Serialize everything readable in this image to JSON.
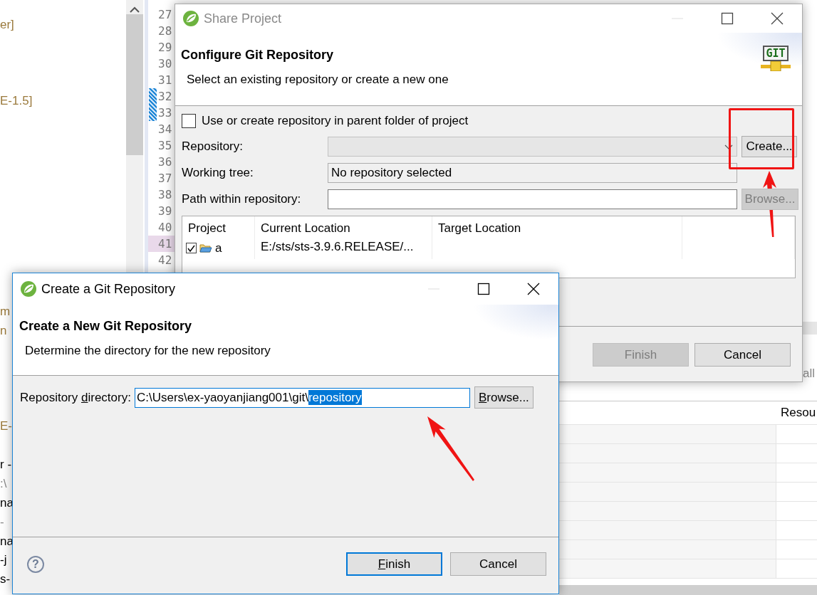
{
  "ide": {
    "explorer_rows": [
      {
        "kind": "decoration",
        "text": "er]"
      },
      {
        "kind": "blank"
      },
      {
        "kind": "blank"
      },
      {
        "kind": "blank"
      },
      {
        "kind": "decoration",
        "text": "E-1.5]"
      },
      {
        "kind": "blank"
      },
      {
        "kind": "blank"
      },
      {
        "kind": "blank"
      },
      {
        "kind": "blank"
      },
      {
        "kind": "blank"
      },
      {
        "kind": "blank"
      },
      {
        "kind": "blank"
      },
      {
        "kind": "blank"
      },
      {
        "kind": "blank"
      },
      {
        "kind": "blank"
      },
      {
        "kind": "decoration",
        "text": "m"
      },
      {
        "kind": "decoration",
        "text": "n"
      },
      {
        "kind": "blank"
      },
      {
        "kind": "blank"
      },
      {
        "kind": "blank"
      },
      {
        "kind": "blank"
      },
      {
        "kind": "decoration",
        "text": "E-"
      },
      {
        "kind": "blank"
      },
      {
        "kind": "label",
        "text": "r -"
      },
      {
        "kind": "path",
        "text": ":\\"
      },
      {
        "kind": "label",
        "text": "na"
      },
      {
        "kind": "path",
        "text": "-"
      },
      {
        "kind": "label",
        "text": "na"
      },
      {
        "kind": "label",
        "text": "-j"
      },
      {
        "kind": "label",
        "text": "s-"
      }
    ],
    "editor_lines": [
      {
        "number": "27",
        "kind": "plain"
      },
      {
        "number": "28",
        "kind": "plain"
      },
      {
        "number": "29",
        "kind": "plain"
      },
      {
        "number": "30",
        "kind": "plain"
      },
      {
        "number": "31",
        "kind": "plain"
      },
      {
        "number": "32",
        "kind": "marked"
      },
      {
        "number": "33",
        "kind": "marked"
      },
      {
        "number": "34",
        "kind": "plain"
      },
      {
        "number": "35",
        "kind": "plain"
      },
      {
        "number": "36",
        "kind": "plain"
      },
      {
        "number": "37",
        "kind": "plain"
      },
      {
        "number": "38",
        "kind": "plain"
      },
      {
        "number": "39",
        "kind": "plain"
      },
      {
        "number": "40",
        "kind": "plain"
      },
      {
        "number": "41",
        "kind": "highlighted"
      },
      {
        "number": "42",
        "kind": "plain"
      }
    ],
    "side_fragment": "all",
    "bottom_table": {
      "column_2": "Resou"
    }
  },
  "share_dialog": {
    "title": "Share Project",
    "active": false,
    "heading": "Configure Git Repository",
    "description": "Select an existing repository or create a new one",
    "logo_text": "GIT",
    "parent_folder_option": {
      "label": "Use or create repository in parent folder of project",
      "checked": false
    },
    "repository": {
      "label": "Repository:",
      "disabled": true
    },
    "create_button": {
      "label": "Create...",
      "disabled": false
    },
    "working_tree": {
      "label": "Working tree:",
      "value": "No repository selected"
    },
    "path": {
      "label": "Path within repository:"
    },
    "browse_button": {
      "label": "Browse...",
      "disabled": true
    },
    "table": {
      "columns": [
        "Project",
        "Current Location",
        "Target Location"
      ],
      "rows": [
        {
          "project": "a",
          "checked": true,
          "current_location": "E:/sts/sts-3.9.6.RELEASE/..."
        }
      ]
    },
    "buttons": [
      {
        "label": "Finish",
        "disabled": true
      },
      {
        "label": "Cancel",
        "disabled": false
      }
    ]
  },
  "create_dialog": {
    "title": "Create a Git Repository",
    "active": true,
    "heading": "Create a New Git Repository",
    "description": "Determine the directory for the new repository",
    "directory": {
      "label": {
        "before": "Repository ",
        "mnemonic": "d",
        "after": "irectory:"
      },
      "value": "C:\\Users\\ex-yaoyanjiang001\\git\\",
      "selected_text": "repository"
    },
    "browse_button": {
      "mnemonic": "B",
      "rest": "rowse..."
    },
    "help_symbol": "?",
    "buttons": [
      {
        "mnemonic": "F",
        "rest": "inish",
        "default": true
      },
      {
        "rest": "Cancel",
        "default": false
      }
    ]
  },
  "annotations": [
    {
      "kind": "highlight-frame"
    },
    {
      "kind": "arrow"
    },
    {
      "kind": "arrow"
    }
  ]
}
